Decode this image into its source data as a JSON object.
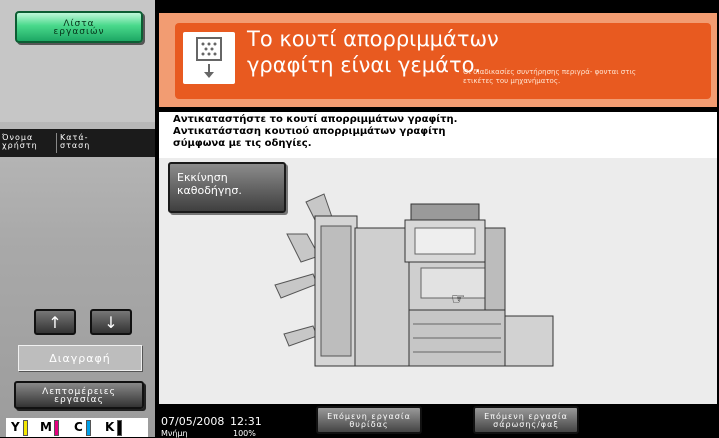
{
  "sidebar": {
    "job_list_button": "Λίστα\nεργασιών",
    "columns": [
      "Όνομα\nχρήστη",
      "Κατά-\nσταση"
    ],
    "up_arrow": "↑",
    "down_arrow": "↓",
    "delete_button": "Διαγραφή",
    "details_button": "Λεπτομέρειες\nεργασίας",
    "toner": [
      {
        "label": "Y",
        "color": "#f2e600"
      },
      {
        "label": "M",
        "color": "#e4007f"
      },
      {
        "label": "C",
        "color": "#00a0e9"
      },
      {
        "label": "K",
        "color": "#000000"
      }
    ]
  },
  "header": {
    "title": "Το κουτί απορριμμάτων γραφίτη είναι γεμάτο.",
    "note": "Οι διαδικασίες συντήρησης περιγρά- φονται στις ετικέτες του μηχανήματος.",
    "accent": "#e85a20",
    "icon": "toner-waste-box-icon"
  },
  "instructions": {
    "line1": "Αντικαταστήστε το κουτί απορριμμάτων γραφίτη.",
    "line2": "Αντικατάσταση κουτιού απορριμμάτων γραφίτη",
    "line3": "σύμφωνα με τις οδηγίες."
  },
  "guide_button": "Εκκίνηση\nκαθοδήγησ.",
  "bottom": {
    "date": "07/05/2008",
    "time": "12:31",
    "memory_label": "Μνήμη",
    "memory_value": "100%",
    "next_copy_job": "Επόμενη εργασία\nθυρίδας",
    "next_scan_job": "Επόμενη εργασία\nσάρωσης/φαξ"
  }
}
